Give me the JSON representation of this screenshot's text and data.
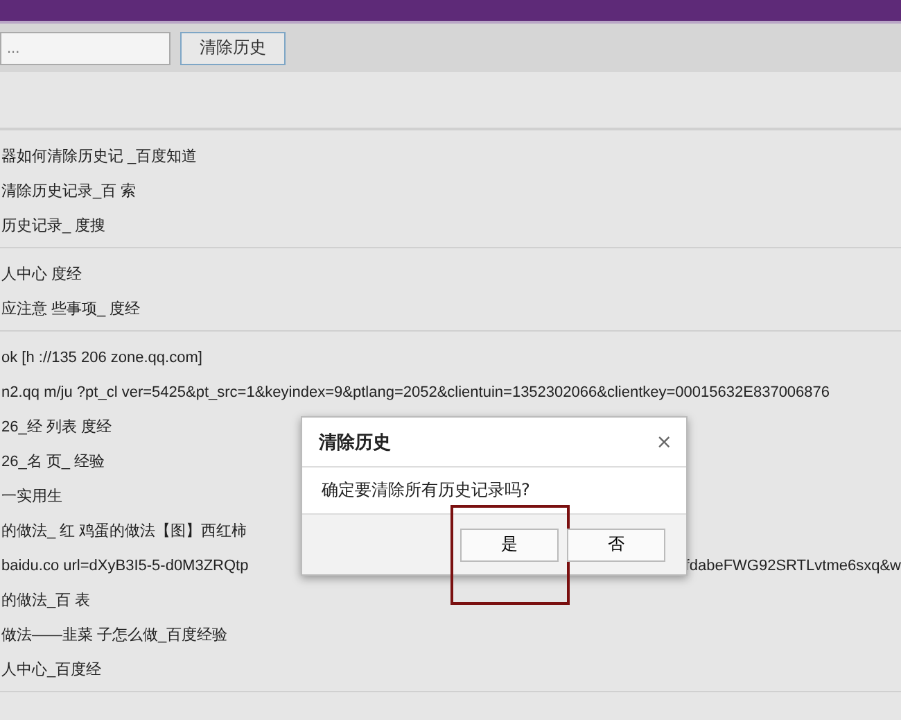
{
  "toolbar": {
    "search": {
      "placeholder": "..."
    },
    "clear_button": "清除历史"
  },
  "history_groups": [
    {
      "rows": [
        {
          "text": "器如何清除历史记 _百度知道"
        },
        {
          "text": "清除历史记录_百 索"
        },
        {
          "text": "历史记录_ 度搜"
        }
      ]
    },
    {
      "rows": [
        {
          "text": "人中心 度经"
        },
        {
          "text": "应注意 些事项_ 度经"
        }
      ]
    },
    {
      "rows": [
        {
          "text": "ok [h ://135 206 zone.qq.com]"
        },
        {
          "text": "n2.qq m/ju ?pt_cl ver=5425&pt_src=1&keyindex=9&ptlang=2052&clientuin=1352302066&clientkey=00015632E837006876"
        },
        {
          "text": "26_经 列表 度经"
        },
        {
          "text": "26_名 页_ 经验"
        },
        {
          "text": "一实用生"
        },
        {
          "text": "的做法_ 红 鸡蛋的做法【图】西红柿"
        },
        {
          "text": "baidu.co url=dXyB3I5-5-d0M3ZRQtp",
          "tail": "fdabeFWG92SRTLvtme6sxq&w"
        },
        {
          "text": "的做法_百 表"
        },
        {
          "text": "做法——韭菜 子怎么做_百度经验"
        },
        {
          "text": "人中心_百度经"
        }
      ]
    }
  ],
  "dialog": {
    "title": "清除历史",
    "close": "×",
    "message": "确定要清除所有历史记录吗?",
    "buttons": [
      {
        "label": "是",
        "highlighted": true
      },
      {
        "label": "否",
        "highlighted": false
      }
    ]
  }
}
